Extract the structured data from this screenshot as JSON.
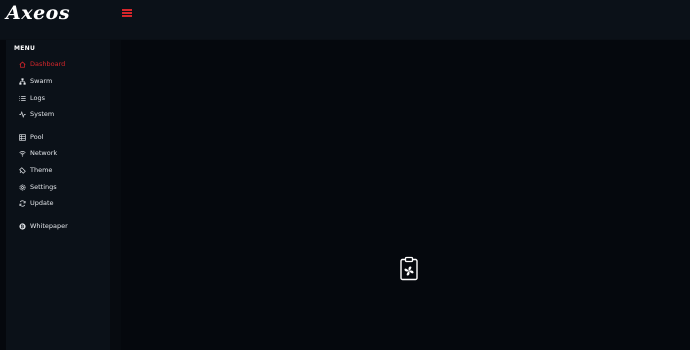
{
  "brand": {
    "name": "Axeos"
  },
  "header": {
    "menu_toggle_icon": "hamburger-icon"
  },
  "sidebar": {
    "heading": "MENU",
    "items": [
      {
        "label": "Dashboard",
        "icon": "home-icon",
        "active": true
      },
      {
        "label": "Swarm",
        "icon": "network-tree-icon",
        "active": false
      },
      {
        "label": "Logs",
        "icon": "list-icon",
        "active": false
      },
      {
        "label": "System",
        "icon": "pulse-icon",
        "active": false
      },
      {
        "label": "Pool",
        "icon": "server-icon",
        "active": false
      },
      {
        "label": "Network",
        "icon": "wifi-icon",
        "active": false
      },
      {
        "label": "Theme",
        "icon": "palette-icon",
        "active": false
      },
      {
        "label": "Settings",
        "icon": "gear-icon",
        "active": false
      },
      {
        "label": "Update",
        "icon": "refresh-icon",
        "active": false
      },
      {
        "label": "Whitepaper",
        "icon": "bitcoin-icon",
        "active": false
      }
    ]
  },
  "main": {
    "loading_icon": "clipboard-fan-icon"
  },
  "colors": {
    "accent": "#d6262b",
    "background": "#05080d",
    "panel": "#0b1118"
  }
}
